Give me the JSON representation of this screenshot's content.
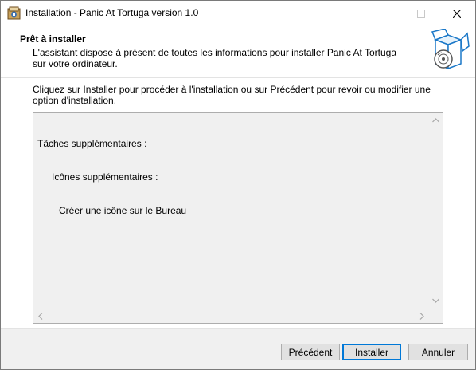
{
  "window": {
    "title": "Installation - Panic At Tortuga version 1.0",
    "app_icon": "setup-app-icon"
  },
  "header": {
    "title": "Prêt à installer",
    "description": "L'assistant dispose à présent de toutes les informations pour installer Panic At Tortuga sur votre ordinateur.",
    "image_icon": "box-disc-icon"
  },
  "body": {
    "instructions": "Cliquez sur Installer pour procéder à l'installation ou sur Précédent pour revoir ou modifier une option d'installation.",
    "memo": {
      "lines": [
        "Tâches supplémentaires :",
        "Icônes supplémentaires :",
        "Créer une icône sur le Bureau"
      ]
    }
  },
  "footer": {
    "back_label": "Précédent",
    "install_label": "Installer",
    "cancel_label": "Annuler"
  },
  "colors": {
    "accent": "#0078d7",
    "button_face": "#e1e1e1",
    "panel": "#f0f0f0"
  }
}
